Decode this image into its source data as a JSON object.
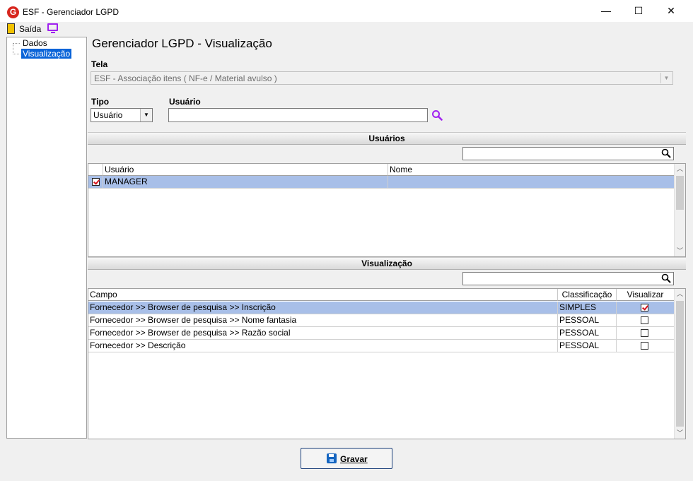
{
  "window": {
    "title": "ESF - Gerenciador LGPD",
    "app_icon": "G",
    "minimize": "—",
    "maximize": "☐",
    "close": "✕"
  },
  "menubar": {
    "exit_label": "Saída"
  },
  "tree": {
    "items": [
      {
        "label": "Dados"
      },
      {
        "label": "Visualização",
        "selected": true
      }
    ]
  },
  "page_title": "Gerenciador LGPD - Visualização",
  "tela": {
    "label": "Tela",
    "value": "ESF - Associação itens ( NF-e / Material avulso )"
  },
  "tipo": {
    "label": "Tipo",
    "value": "Usuário"
  },
  "usuario": {
    "label": "Usuário",
    "value": ""
  },
  "usuarios_section": {
    "title": "Usuários",
    "columns": [
      "Usuário",
      "Nome"
    ],
    "rows": [
      {
        "checked": true,
        "usuario": "MANAGER",
        "nome": ""
      }
    ]
  },
  "visualizacao_section": {
    "title": "Visualização",
    "columns": [
      "Campo",
      "Classificação",
      "Visualizar"
    ],
    "rows": [
      {
        "campo": "Fornecedor >> Browser de pesquisa >> Inscrição",
        "classificacao": "SIMPLES",
        "visualizar": true
      },
      {
        "campo": "Fornecedor >> Browser de pesquisa >> Nome fantasia",
        "classificacao": "PESSOAL",
        "visualizar": false
      },
      {
        "campo": "Fornecedor >> Browser de pesquisa >> Razão social",
        "classificacao": "PESSOAL",
        "visualizar": false
      },
      {
        "campo": "Fornecedor >> Descrição",
        "classificacao": "PESSOAL",
        "visualizar": false
      }
    ]
  },
  "footer": {
    "save_label": "Gravar"
  },
  "colors": {
    "selection": "#a8bfe8",
    "tree_selection": "#0a64d8",
    "check_red": "#d4121c",
    "search_icon_purple": "#a020f0",
    "save_icon_blue": "#1565c0"
  }
}
